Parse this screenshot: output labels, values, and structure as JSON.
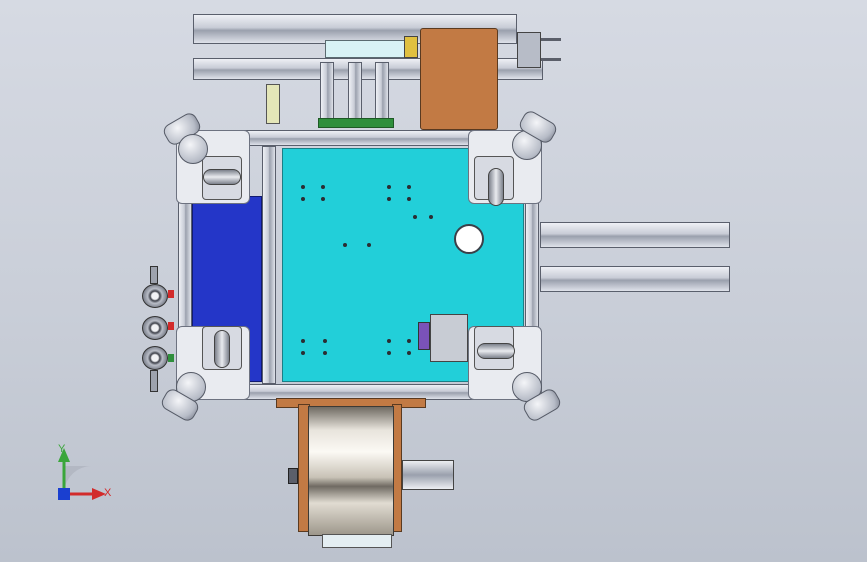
{
  "viewport": {
    "background": "#c9ced8",
    "triad": {
      "y_label": "Y",
      "x_label": "X",
      "y_color": "#3aa63a",
      "x_color": "#d22b2b",
      "z_color": "#1a3fd0"
    }
  },
  "colors": {
    "table_top": "#22cfd9",
    "blue_panel": "#2436c8",
    "motor_block": "#c27a44",
    "green_pcb": "#2f8f3c",
    "frame": "#e9ebf0"
  },
  "icons": {
    "axis_triad": "axis-triad-icon",
    "caster": "caster-wheel-icon",
    "leveling_knob": "leveling-knob-icon",
    "valve": "pneumatic-valve-icon",
    "drum": "roller-drum-icon"
  }
}
